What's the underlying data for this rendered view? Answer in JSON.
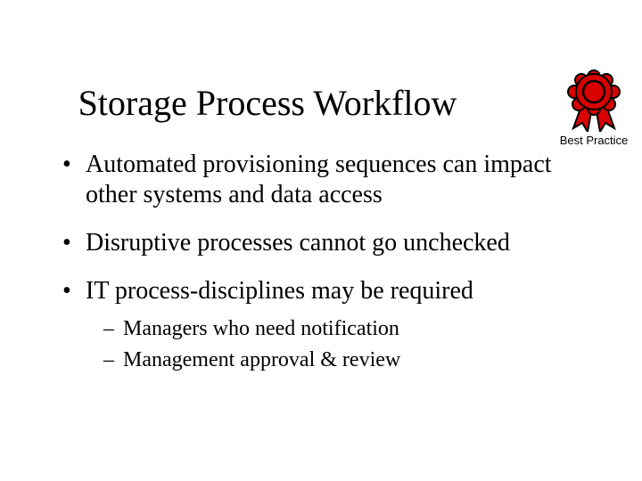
{
  "title": "Storage Process Workflow",
  "badge": {
    "label": "Best Practice"
  },
  "bullets": [
    {
      "text": "Automated provisioning sequences can impact other systems and data access"
    },
    {
      "text": "Disruptive processes cannot go unchecked"
    },
    {
      "text": "IT process-disciplines may be required",
      "sub": [
        "Managers who need notification",
        "Management approval &  review"
      ]
    }
  ]
}
